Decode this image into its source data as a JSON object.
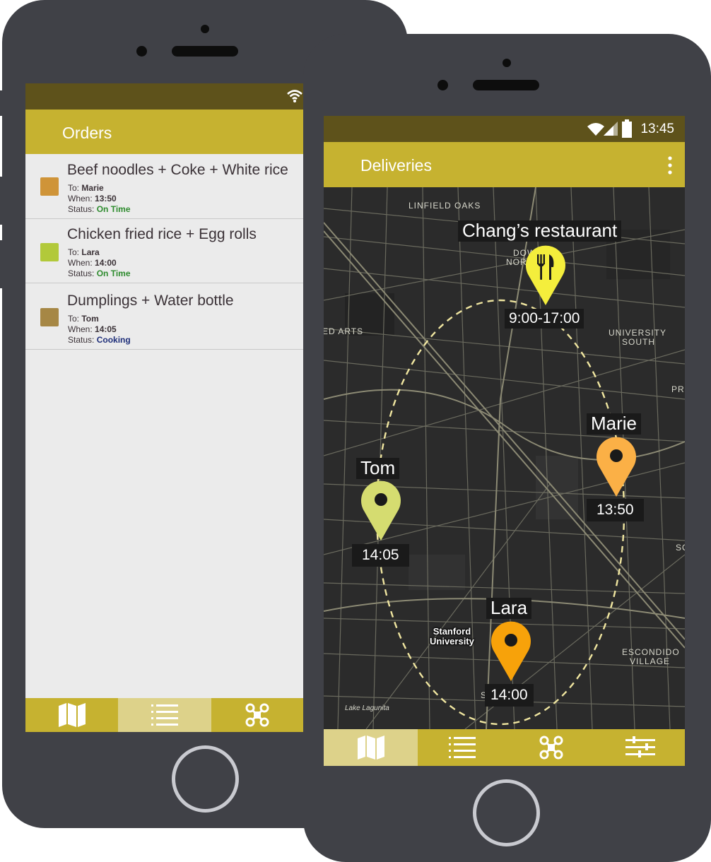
{
  "orders_screen": {
    "title": "Orders",
    "orders": [
      {
        "title": "Beef noodles + Coke + White rice",
        "to_label": "To:",
        "to": "Marie",
        "when_label": "When:",
        "when": "13:50",
        "status_label": "Status:",
        "status": "On Time",
        "color": "#cf9438"
      },
      {
        "title": "Chicken fried rice + Egg rolls",
        "to_label": "To:",
        "to": "Lara",
        "when_label": "When:",
        "when": "14:00",
        "status_label": "Status:",
        "status": "On Time",
        "color": "#b2c93a"
      },
      {
        "title": "Dumplings + Water bottle",
        "to_label": "To:",
        "to": "Tom",
        "when_label": "When:",
        "when": "14:05",
        "status_label": "Status:",
        "status": "Cooking",
        "color": "#a68745"
      }
    ],
    "nav": [
      {
        "icon": "map-icon",
        "active": false
      },
      {
        "icon": "list-icon",
        "active": true
      },
      {
        "icon": "drone-icon",
        "active": false
      }
    ]
  },
  "deliveries_screen": {
    "title": "Deliveries",
    "status_time": "13:45",
    "map": {
      "labels": [
        "LINFIELD OAKS",
        "DOWNT",
        "NOR",
        "ED ARTS",
        "UNIVERSITY",
        "SOUTH",
        "PR",
        "SO",
        "ESCONDIDO",
        "VILLAGE",
        "Lake Lagunita",
        "St"
      ],
      "stanford": [
        "Stanford",
        "University"
      ],
      "restaurant": {
        "name": "Chang’s restaurant",
        "hours": "9:00-17:00"
      },
      "deliveries": [
        {
          "name": "Marie",
          "time": "13:50",
          "color": "#fbb046"
        },
        {
          "name": "Tom",
          "time": "14:05",
          "color": "#d5dc70"
        },
        {
          "name": "Lara",
          "time": "14:00",
          "color": "#f7a20a"
        }
      ]
    },
    "nav": [
      {
        "icon": "map-icon",
        "active": true
      },
      {
        "icon": "list-icon",
        "active": false
      },
      {
        "icon": "drone-icon",
        "active": false
      },
      {
        "icon": "sliders-icon",
        "active": false
      }
    ]
  },
  "colors": {
    "phone": "#404147",
    "status_bar": "#5e521b",
    "header": "#c6b230",
    "nav_active": "#ddd28a",
    "route": "#f0e6a0"
  }
}
